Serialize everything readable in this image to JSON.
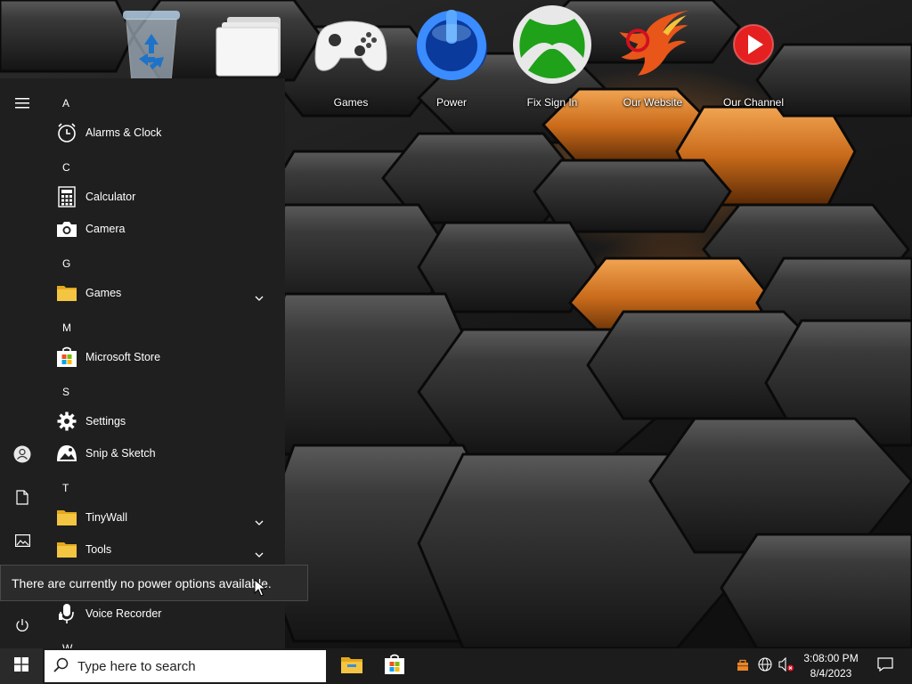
{
  "desktop": {
    "icons": [
      {
        "name": "recycle-bin",
        "label": ""
      },
      {
        "name": "folder",
        "label": ""
      },
      {
        "name": "games",
        "label": "Games"
      },
      {
        "name": "power",
        "label": "Power"
      },
      {
        "name": "fix-sign-in",
        "label": "Fix Sign In"
      },
      {
        "name": "our-website",
        "label": "Our Website"
      },
      {
        "name": "our-channel",
        "label": "Our Channel"
      }
    ]
  },
  "start_menu": {
    "groups": [
      {
        "letter": "A",
        "apps": [
          {
            "label": "Alarms & Clock",
            "icon": "alarm-clock-icon"
          }
        ]
      },
      {
        "letter": "C",
        "apps": [
          {
            "label": "Calculator",
            "icon": "calculator-icon"
          },
          {
            "label": "Camera",
            "icon": "camera-icon"
          }
        ]
      },
      {
        "letter": "G",
        "apps": [
          {
            "label": "Games",
            "icon": "folder-icon",
            "expandable": true
          }
        ]
      },
      {
        "letter": "M",
        "apps": [
          {
            "label": "Microsoft Store",
            "icon": "store-icon"
          }
        ]
      },
      {
        "letter": "S",
        "apps": [
          {
            "label": "Settings",
            "icon": "gear-icon"
          },
          {
            "label": "Snip & Sketch",
            "icon": "snip-icon"
          }
        ]
      },
      {
        "letter": "T",
        "apps": [
          {
            "label": "TinyWall",
            "icon": "folder-icon",
            "expandable": true
          },
          {
            "label": "Tools",
            "icon": "folder-icon",
            "expandable": true
          }
        ]
      },
      {
        "letter": "",
        "apps": [
          {
            "label": "Voice Recorder",
            "icon": "microphone-icon"
          }
        ]
      },
      {
        "letter": "W",
        "apps": []
      }
    ]
  },
  "tooltip": {
    "text": "There are currently no power options available."
  },
  "taskbar": {
    "search_placeholder": "Type here to search",
    "clock_time": "3:08:00 PM",
    "clock_date": "8/4/2023"
  },
  "colors": {
    "start_bg": "#1f1f1f",
    "taskbar_bg": "#1c1c1c",
    "folder_yellow": "#f4c542",
    "accent_orange": "#e8862a"
  }
}
